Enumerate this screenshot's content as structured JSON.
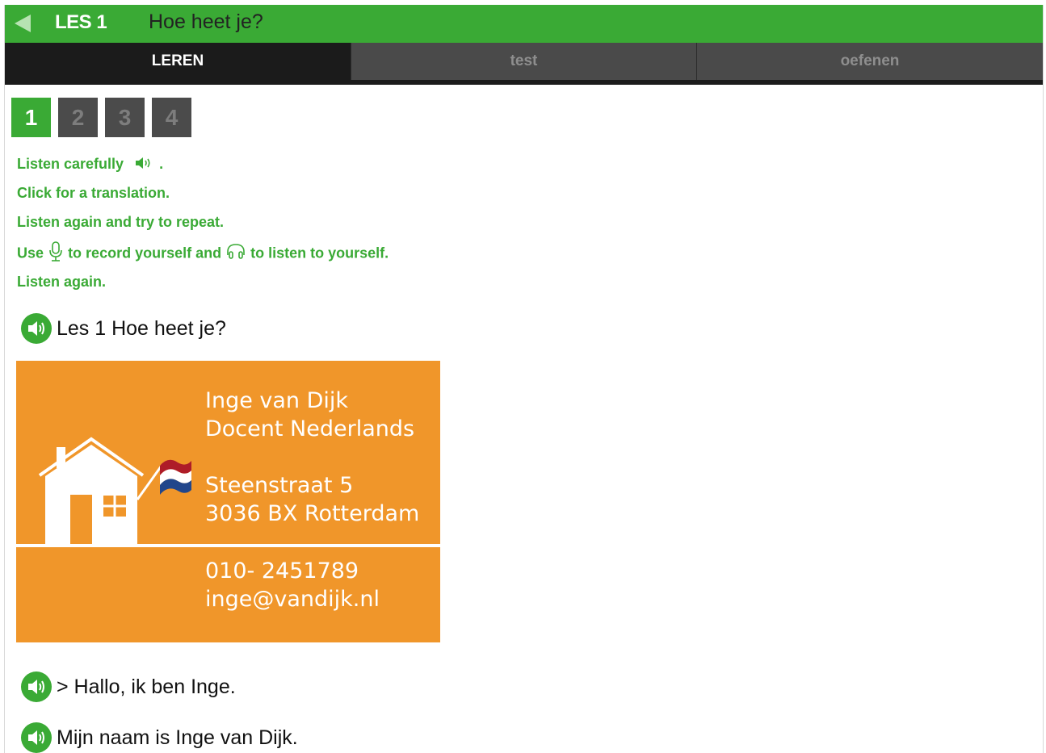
{
  "header": {
    "lesson_number": "LES 1",
    "lesson_title": "Hoe heet je?"
  },
  "tabs": [
    {
      "label": "LEREN",
      "active": true
    },
    {
      "label": "test",
      "active": false
    },
    {
      "label": "oefenen",
      "active": false
    }
  ],
  "steps": [
    {
      "label": "1",
      "active": true
    },
    {
      "label": "2",
      "active": false
    },
    {
      "label": "3",
      "active": false
    },
    {
      "label": "4",
      "active": false
    }
  ],
  "instructions": {
    "line1_text": "Listen carefully",
    "line1_end": ".",
    "line2": "Click for a translation.",
    "line3": "Listen again and try to repeat.",
    "line4_use": "Use",
    "line4_record": "to record yourself and",
    "line4_listen": "to listen to yourself.",
    "line5": "Listen again."
  },
  "phrases": [
    {
      "text": "Les 1 Hoe heet je?"
    },
    {
      "text": "> Hallo, ik ben Inge."
    },
    {
      "text": "Mijn naam is Inge van Dijk."
    }
  ],
  "business_card": {
    "name": "Inge van Dijk",
    "role": "Docent Nederlands",
    "street": "Steenstraat 5",
    "city": "3036 BX Rotterdam",
    "phone": "010- 2451789",
    "email": "inge@vandijk.nl"
  },
  "icons": {
    "back": "back-arrow-icon",
    "speaker": "speaker-icon",
    "microphone": "microphone-icon",
    "headphones": "headphones-icon"
  },
  "colors": {
    "green": "#3aaa35",
    "orange": "#f0962a",
    "dark": "#1b1b1b",
    "tab_inactive": "#4a4a4a"
  }
}
